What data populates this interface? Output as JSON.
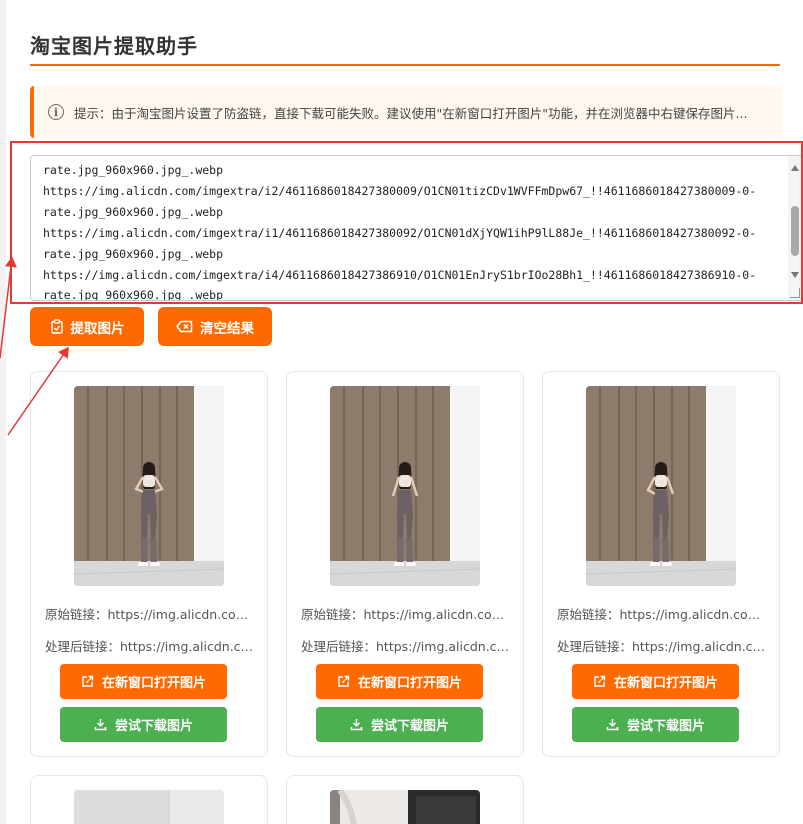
{
  "page_title": "淘宝图片提取助手",
  "notice": {
    "text": "提示：由于淘宝图片设置了防盗链，直接下载可能失败。建议使用\"在新窗口打开图片\"功能，并在浏览器中右键保存图片..."
  },
  "url_input": {
    "lines": [
      "rate.jpg_960x960.jpg_.webp",
      "https://img.alicdn.com/imgextra/i2/4611686018427380009/O1CN01tizCDv1WVFFmDpw67_!!4611686018427380009-0-",
      "rate.jpg_960x960.jpg_.webp",
      "https://img.alicdn.com/imgextra/i1/4611686018427380092/O1CN01dXjYQW1ihP9lL88Je_!!4611686018427380092-0-",
      "rate.jpg_960x960.jpg_.webp",
      "https://img.alicdn.com/imgextra/i4/4611686018427386910/O1CN01EnJryS1brIOo28Bh1_!!4611686018427386910-0-",
      "rate.jpg_960x960.jpg_.webp"
    ]
  },
  "buttons": {
    "extract_label": "提取图片",
    "clear_label": "清空结果"
  },
  "cards": [
    {
      "original_link": "原始链接：https://img.alicdn.com...",
      "processed_link": "处理后链接：https://img.alicdn.co...",
      "open_label": "在新窗口打开图片",
      "download_label": "尝试下载图片"
    },
    {
      "original_link": "原始链接：https://img.alicdn.com...",
      "processed_link": "处理后链接：https://img.alicdn.co...",
      "open_label": "在新窗口打开图片",
      "download_label": "尝试下载图片"
    },
    {
      "original_link": "原始链接：https://img.alicdn.com...",
      "processed_link": "处理后链接：https://img.alicdn.co...",
      "open_label": "在新窗口打开图片",
      "download_label": "尝试下载图片"
    }
  ],
  "colors": {
    "accent": "#ff6a00",
    "download": "#4caf50",
    "annotation": "#e53935"
  }
}
